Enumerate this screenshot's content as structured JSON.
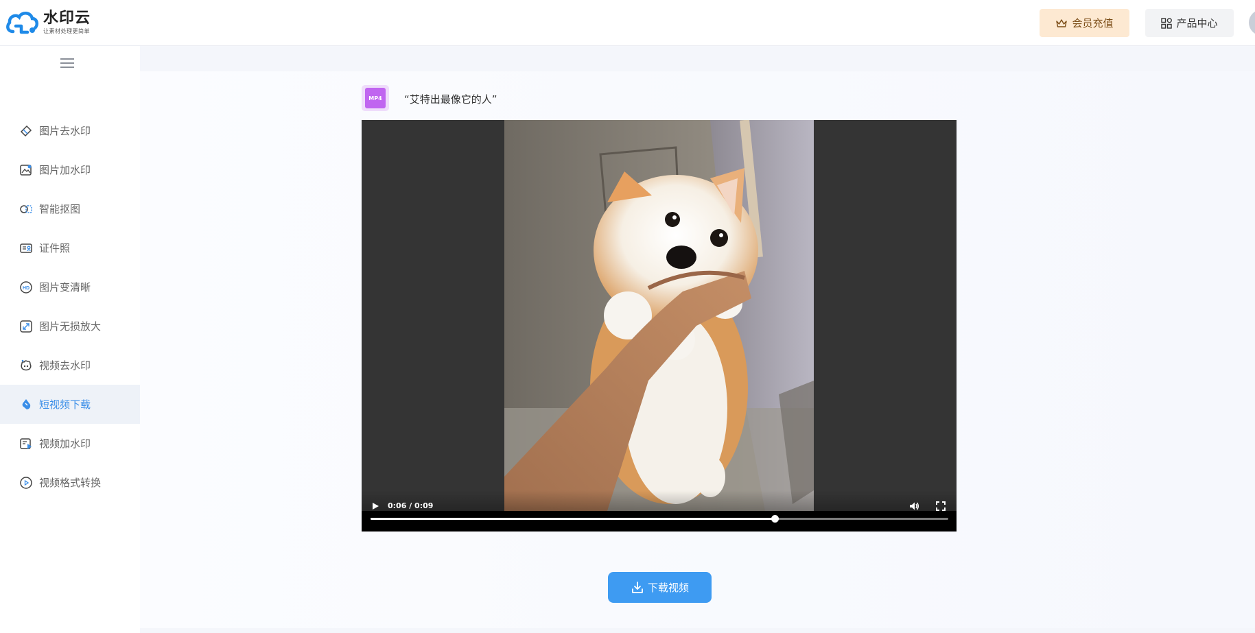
{
  "header": {
    "logo_title": "水印云",
    "logo_slogan": "让素材处理更简单",
    "vip_button": "会员充值",
    "product_button": "产品中心"
  },
  "sidebar": {
    "items": [
      {
        "label": "图片去水印",
        "icon": "eraser-icon"
      },
      {
        "label": "图片加水印",
        "icon": "image-stamp-icon"
      },
      {
        "label": "智能抠图",
        "icon": "cutout-icon"
      },
      {
        "label": "证件照",
        "icon": "id-card-icon"
      },
      {
        "label": "图片变清晰",
        "icon": "hd-icon"
      },
      {
        "label": "图片无损放大",
        "icon": "expand-icon"
      },
      {
        "label": "视频去水印",
        "icon": "video-erase-icon"
      },
      {
        "label": "短视频下载",
        "icon": "download-drop-icon",
        "active": true
      },
      {
        "label": "视频加水印",
        "icon": "video-stamp-icon"
      },
      {
        "label": "视频格式转换",
        "icon": "play-circle-icon"
      }
    ]
  },
  "main": {
    "file_type": "MP4",
    "file_title": "“艾特出最像它的人”",
    "video": {
      "time": "0:06 / 0:09",
      "progress": 0.7
    },
    "download_button": "下载视频"
  },
  "colors": {
    "accent": "#3e9bf2",
    "vip_bg": "#fde9d2",
    "active_bg": "#eef2f8",
    "badge": "#c065f0"
  }
}
